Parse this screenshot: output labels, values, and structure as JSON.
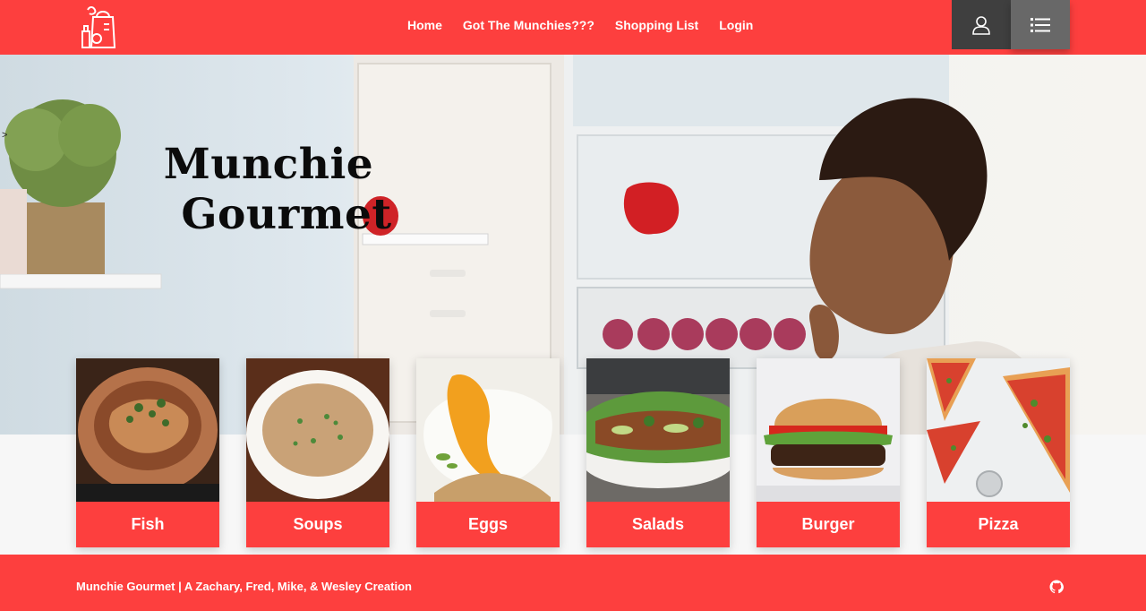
{
  "navbar": {
    "logo_icon": "grocery-bag-icon",
    "links": [
      {
        "label": "Home"
      },
      {
        "label": "Got The Munchies???"
      },
      {
        "label": "Shopping List"
      },
      {
        "label": "Login"
      }
    ],
    "user_icon": "user-icon",
    "list_icon": "list-icon"
  },
  "hero": {
    "caret": ">",
    "title_line1": "Munchie",
    "title_line2": "Gourmet"
  },
  "categories": [
    {
      "label": "Fish"
    },
    {
      "label": "Soups"
    },
    {
      "label": "Eggs"
    },
    {
      "label": "Salads"
    },
    {
      "label": "Burger"
    },
    {
      "label": "Pizza"
    }
  ],
  "footer": {
    "text": "Munchie Gourmet | A Zachary, Fred, Mike, & Wesley Creation",
    "github_icon": "github-icon"
  },
  "colors": {
    "brand_red": "#fd3f3e",
    "dark_button": "#3f3f3f",
    "gray_button": "#686868"
  }
}
